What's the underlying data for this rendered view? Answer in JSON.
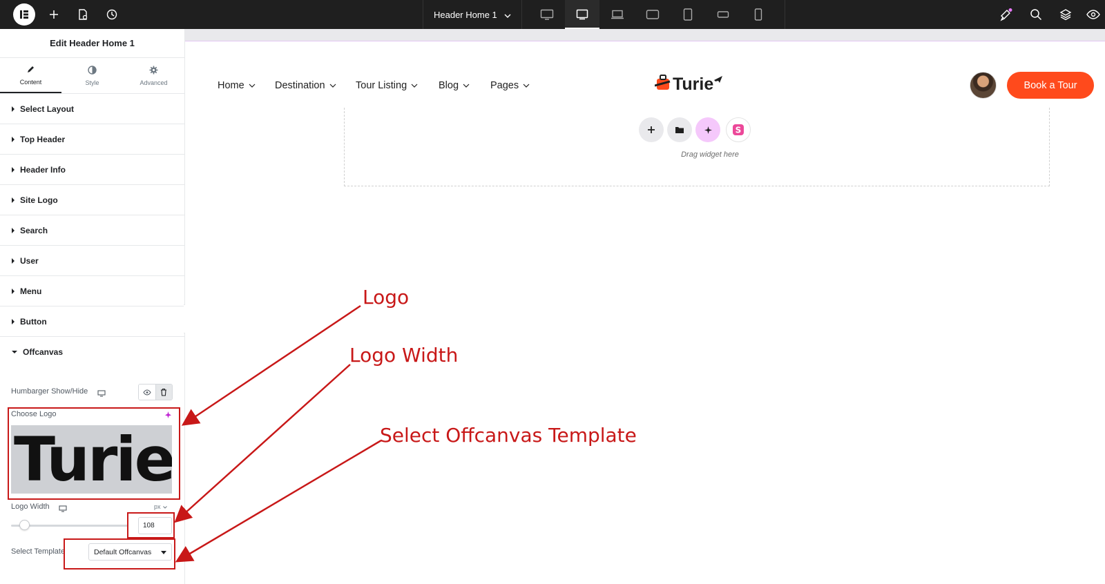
{
  "topbar": {
    "document_title": "Header Home 1",
    "icons": [
      "elementor-logo-icon",
      "add-icon",
      "page-settings-icon",
      "history-icon",
      "desktop-icon",
      "tablet-landscape-icon",
      "laptop-icon",
      "tablet-icon",
      "mobile-portrait-icon",
      "mobile-landscape-icon",
      "mobile-icon",
      "notifications-icon",
      "search-icon",
      "layers-icon",
      "preview-eye-icon"
    ]
  },
  "sidebar": {
    "title": "Edit Header Home 1",
    "tabs": [
      {
        "label": "Content",
        "icon": "pencil-icon",
        "active": true
      },
      {
        "label": "Style",
        "icon": "half-circle-icon",
        "active": false
      },
      {
        "label": "Advanced",
        "icon": "gear-icon",
        "active": false
      }
    ],
    "sections": [
      "Select Layout",
      "Top Header",
      "Header Info",
      "Site Logo",
      "Search",
      "User",
      "Menu",
      "Button",
      "Offcanvas"
    ],
    "offcanvas": {
      "hamburger_label": "Humbarger Show/Hide",
      "choose_logo_label": "Choose Logo",
      "logo_preview_text": "Turie",
      "logo_width_label": "Logo Width",
      "logo_width_unit": "px",
      "logo_width_value": "108",
      "select_template_label": "Select Template",
      "select_template_value": "Default Offcanvas"
    }
  },
  "canvas": {
    "nav": [
      "Home",
      "Destination",
      "Tour Listing",
      "Blog",
      "Pages"
    ],
    "brand": "Turie",
    "cta": "Book a Tour",
    "dropzone_text": "Drag widget here"
  },
  "annotations": {
    "logo": "Logo",
    "logo_width": "Logo Width",
    "select_template": "Select Offcanvas Template"
  },
  "colors": {
    "accent": "#ff4a1c",
    "annotation": "#c81818",
    "topbar": "#1f1f1f"
  }
}
